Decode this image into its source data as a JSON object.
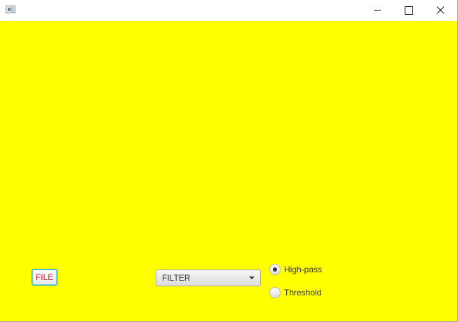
{
  "window": {
    "icon": "app-window-icon",
    "controls": [
      "minimize-icon",
      "maximize-icon",
      "close-icon"
    ],
    "background_color": "#ffff00"
  },
  "toolbar": {
    "file_label": "FILE",
    "file_label_color": "#e0102a",
    "filter_select": {
      "selected": "FILTER"
    },
    "radios": [
      {
        "label": "High-pass",
        "checked": true
      },
      {
        "label": "Threshold",
        "checked": false
      }
    ]
  }
}
